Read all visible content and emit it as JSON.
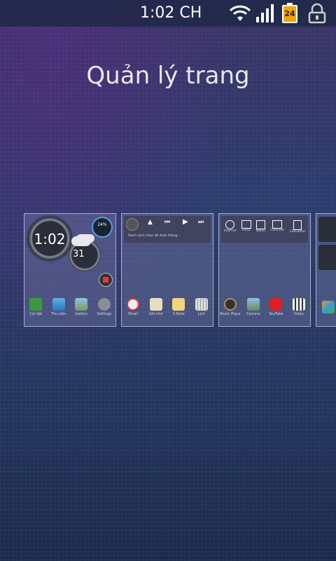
{
  "statusbar": {
    "time": "1:02 CH",
    "battery_level": "24"
  },
  "title": "Quản lý trang",
  "pages": [
    {
      "clock_time": "1:02",
      "weather_temp": "31",
      "battery_widget": "24%",
      "dock": [
        "Cài đặt",
        "Thư viện",
        "Gallery",
        "Settings"
      ]
    },
    {
      "music_caption": "Danh sách nhạc đã được thông...",
      "dock": [
        "Email",
        "Ghi nhớ",
        "S Note",
        "Lịch"
      ]
    },
    {
      "shortcuts": [
        "Internet",
        "Video",
        "Notes",
        "Calendar",
        "Calculator"
      ],
      "dock": [
        "Music Player",
        "Camera",
        "YouTube",
        "Video"
      ]
    }
  ],
  "colors": {
    "accent": "#4fa3e0",
    "youtube": "#e02020"
  }
}
